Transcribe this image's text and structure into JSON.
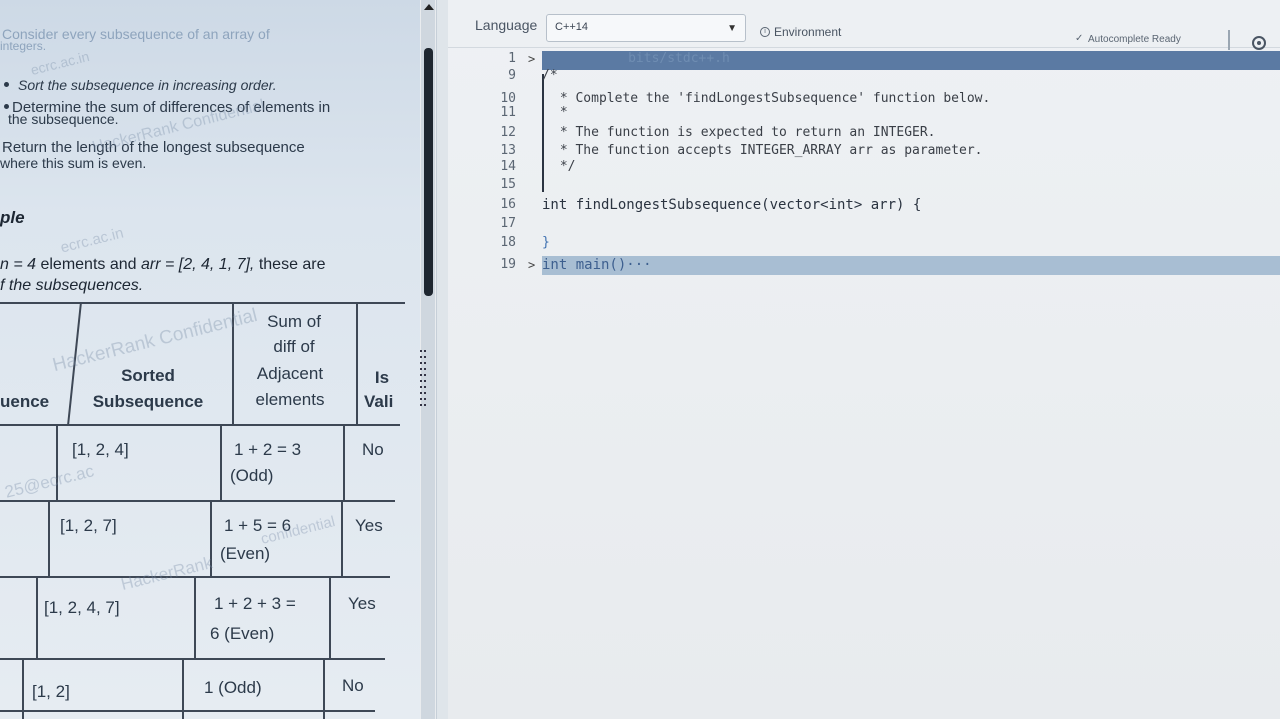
{
  "problem": {
    "intro_line1": "Consider every subsequence of an array of",
    "intro_line2": "integers.",
    "bullet1": "Sort the subsequence in increasing order.",
    "bullet2_line1": "Determine the sum of differences of elements in",
    "bullet2_line2": "the subsequence.",
    "result_line1": "Return the length of the longest subsequence",
    "result_line2": "where this sum is even."
  },
  "example": {
    "heading": "ple",
    "intro_n": "n = 4",
    "intro_mid": " elements and ",
    "intro_arr": "arr = [2, 4, 1, 7],",
    "intro_end": " these are",
    "intro_line2": "f the subsequences."
  },
  "table": {
    "headers": {
      "subsequence": "uence",
      "sorted_line1": "Sorted",
      "sorted_line2": "Subsequence",
      "sum_line1": "Sum of",
      "sum_line2": "diff of",
      "sum_line3": "Adjacent",
      "sum_line4": "elements",
      "valid_line1": "Is",
      "valid_line2": "Vali"
    },
    "rows": [
      {
        "sorted": "[1, 2, 4]",
        "sum_line1": "1 + 2 = 3",
        "sum_line2": "(Odd)",
        "valid": "No"
      },
      {
        "sorted": "[1, 2, 7]",
        "sum_line1": "1 + 5 = 6",
        "sum_line2": "(Even)",
        "valid": "Yes"
      },
      {
        "sorted": "[1, 2, 4, 7]",
        "sum_line1": "1 + 2 + 3 =",
        "sum_line2": "6 (Even)",
        "valid": "Yes"
      },
      {
        "sorted": "[1, 2]",
        "sum_line1": "1 (Odd)",
        "sum_line2": "",
        "valid": "No"
      }
    ]
  },
  "watermarks": [
    "HackerRank Confidential",
    "ecrc.ac.in",
    "HackerRank Confidential",
    "25@ecrc.ac",
    "confidential",
    "HackerRank"
  ],
  "editor": {
    "language_label": "Language",
    "language_value": "C++14",
    "environment_label": "Environment",
    "autocomplete_label": "Autocomplete Ready",
    "lines": [
      {
        "num": "1",
        "fold": ">",
        "text": "           bits/stdc++.h"
      },
      {
        "num": "9",
        "fold": "",
        "text": "/*"
      },
      {
        "num": "10",
        "fold": "",
        "text": " * Complete the 'findLongestSubsequence' function below."
      },
      {
        "num": "11",
        "fold": "",
        "text": " *"
      },
      {
        "num": "12",
        "fold": "",
        "text": " * The function is expected to return an INTEGER."
      },
      {
        "num": "13",
        "fold": "",
        "text": " * The function accepts INTEGER_ARRAY arr as parameter."
      },
      {
        "num": "14",
        "fold": "",
        "text": " */"
      },
      {
        "num": "15",
        "fold": "",
        "text": ""
      },
      {
        "num": "16",
        "fold": "",
        "text": "int findLongestSubsequence(vector<int> arr) {"
      },
      {
        "num": "17",
        "fold": "",
        "text": ""
      },
      {
        "num": "18",
        "fold": "",
        "text": "}"
      },
      {
        "num": "19",
        "fold": ">",
        "text": "int main()···"
      }
    ]
  },
  "colors": {
    "editor_highlight": "#a8bed3",
    "header_highlight": "#5b7aa3",
    "keyword": "#3d6fb0",
    "scroll_thumb": "#1f2730"
  }
}
